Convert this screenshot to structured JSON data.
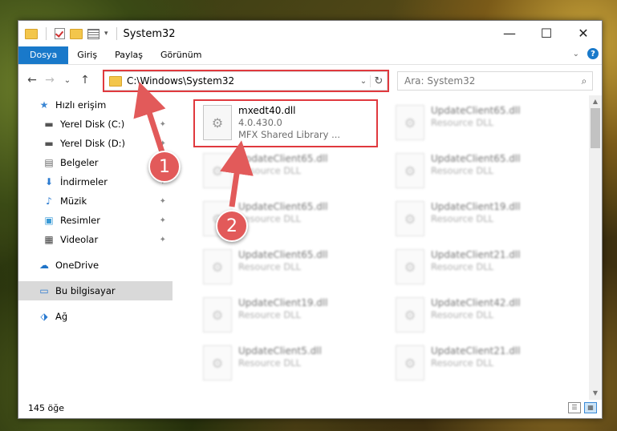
{
  "window": {
    "title": "System32",
    "controls": {
      "minimize": "—",
      "maximize": "☐",
      "close": "✕"
    }
  },
  "ribbon": {
    "tabs": [
      "Dosya",
      "Giriş",
      "Paylaş",
      "Görünüm"
    ],
    "expand_icon": "chevron-down-icon",
    "help_label": "?"
  },
  "nav": {
    "back": "←",
    "forward": "→",
    "recent": "⌄",
    "up": "↑",
    "address": "C:\\Windows\\System32",
    "refresh": "↻",
    "search_placeholder": "Ara: System32"
  },
  "sidebar": {
    "items": [
      {
        "label": "Hızlı erişim",
        "icon": "star-icon",
        "glyph": "★",
        "color": "#3a86d4",
        "pinned": false
      },
      {
        "label": "Yerel Disk (C:)",
        "icon": "drive-icon",
        "glyph": "▬",
        "color": "#555555",
        "pinned": true
      },
      {
        "label": "Yerel Disk (D:)",
        "icon": "drive-icon",
        "glyph": "▬",
        "color": "#555555",
        "pinned": true
      },
      {
        "label": "Belgeler",
        "icon": "document-icon",
        "glyph": "▤",
        "color": "#6a6a6a",
        "pinned": true
      },
      {
        "label": "İndirmeler",
        "icon": "download-icon",
        "glyph": "⬇",
        "color": "#2a7ad0",
        "pinned": true
      },
      {
        "label": "Müzik",
        "icon": "music-icon",
        "glyph": "♪",
        "color": "#2a7ad0",
        "pinned": true
      },
      {
        "label": "Resimler",
        "icon": "pictures-icon",
        "glyph": "▣",
        "color": "#3a9ad6",
        "pinned": true
      },
      {
        "label": "Videolar",
        "icon": "video-icon",
        "glyph": "▦",
        "color": "#444444",
        "pinned": true
      },
      {
        "label": "OneDrive",
        "icon": "cloud-icon",
        "glyph": "☁",
        "color": "#1e73c8",
        "pinned": false
      },
      {
        "label": "Bu bilgisayar",
        "icon": "computer-icon",
        "glyph": "▭",
        "color": "#2a7ad0",
        "pinned": false,
        "selected": true
      },
      {
        "label": "Ağ",
        "icon": "network-icon",
        "glyph": "⬗",
        "color": "#2a7ad0",
        "pinned": false
      }
    ]
  },
  "files": [
    {
      "name": "mxedt40.dll",
      "line2": "4.0.430.0",
      "line3": "MFX Shared Library ...",
      "blurred": false
    },
    {
      "name": "UpdateClient65.dll",
      "line2": "Resource DLL",
      "blurred": true
    },
    {
      "name": "UpdateClient65.dll",
      "line2": "Resource DLL",
      "blurred": true
    },
    {
      "name": "UpdateClient65.dll",
      "line2": "Resource DLL",
      "blurred": true
    },
    {
      "name": "UpdateClient65.dll",
      "line2": "Resource DLL",
      "blurred": true
    },
    {
      "name": "UpdateClient19.dll",
      "line2": "Resource DLL",
      "blurred": true
    },
    {
      "name": "UpdateClient65.dll",
      "line2": "Resource DLL",
      "blurred": true
    },
    {
      "name": "UpdateClient21.dll",
      "line2": "Resource DLL",
      "blurred": true
    },
    {
      "name": "UpdateClient19.dll",
      "line2": "Resource DLL",
      "blurred": true
    },
    {
      "name": "UpdateClient42.dll",
      "line2": "Resource DLL",
      "blurred": true
    },
    {
      "name": "UpdateClient5.dll",
      "line2": "Resource DLL",
      "blurred": true
    },
    {
      "name": "UpdateClient21.dll",
      "line2": "Resource DLL",
      "blurred": true
    }
  ],
  "status": {
    "count": "145 öğe"
  },
  "annotations": {
    "badge1": "1",
    "badge2": "2",
    "color": "#e0393e"
  }
}
